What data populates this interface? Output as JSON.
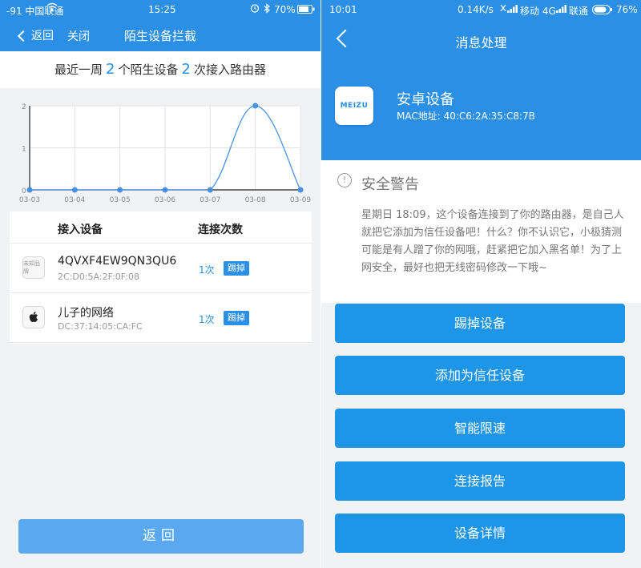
{
  "left": {
    "status": {
      "signal": "-91 中国联通",
      "time": "15:25",
      "battery": "70%"
    },
    "nav": {
      "back": "返回",
      "close": "关闭",
      "title": "陌生设备拦截"
    },
    "summary": {
      "prefix": "最近一周",
      "devices": "2",
      "mid": "个陌生设备",
      "times": "2",
      "suffix": "次接入路由器"
    },
    "table": {
      "col_device": "接入设备",
      "col_count": "连接次数",
      "rows": [
        {
          "icon_text": "未知品牌",
          "name": "4QVXF4EW9QN3QU6",
          "mac": "2C:D0:5A:2F:0F:08",
          "count": "1次",
          "action": "踢掉"
        },
        {
          "icon": "apple-icon",
          "name": "儿子的网络",
          "mac": "DC:37:14:05:CA:FC",
          "count": "1次",
          "action": "踢掉"
        }
      ]
    },
    "back_button": "返回"
  },
  "chart_data": {
    "type": "line",
    "categories": [
      "03-03",
      "03-04",
      "03-05",
      "03-06",
      "03-07",
      "03-08",
      "03-09"
    ],
    "values": [
      0,
      0,
      0,
      0,
      0,
      2,
      0
    ],
    "yticks": [
      0,
      1,
      2
    ],
    "ylim": [
      0,
      2
    ],
    "grid": true,
    "line_color": "#4a90e2"
  },
  "right": {
    "status": {
      "time": "10:01",
      "speed": "0.14K/s",
      "carrier1": "移动 4G",
      "carrier2": "联通",
      "battery": "76%"
    },
    "title": "消息处理",
    "device": {
      "logo_text": "MEIZU",
      "name": "安卓设备",
      "mac": "MAC地址: 40:C6:2A:35:C8:7B"
    },
    "warning": {
      "title": "安全警告",
      "text": "星期日 18:09，这个设备连接到了你的路由器，是自己人就把它添加为信任设备吧！什么？你不认识它，小极猜测可能是有人蹭了你的网哦，赶紧把它加入黑名单！为了上网安全，最好也把无线密码修改一下哦~"
    },
    "buttons": [
      "踢掉设备",
      "添加为信任设备",
      "智能限速",
      "连接报告",
      "设备详情"
    ]
  },
  "colors": {
    "primary": "#2b8fe6",
    "button": "#1f95e8",
    "back_button": "#5aa8f0"
  }
}
